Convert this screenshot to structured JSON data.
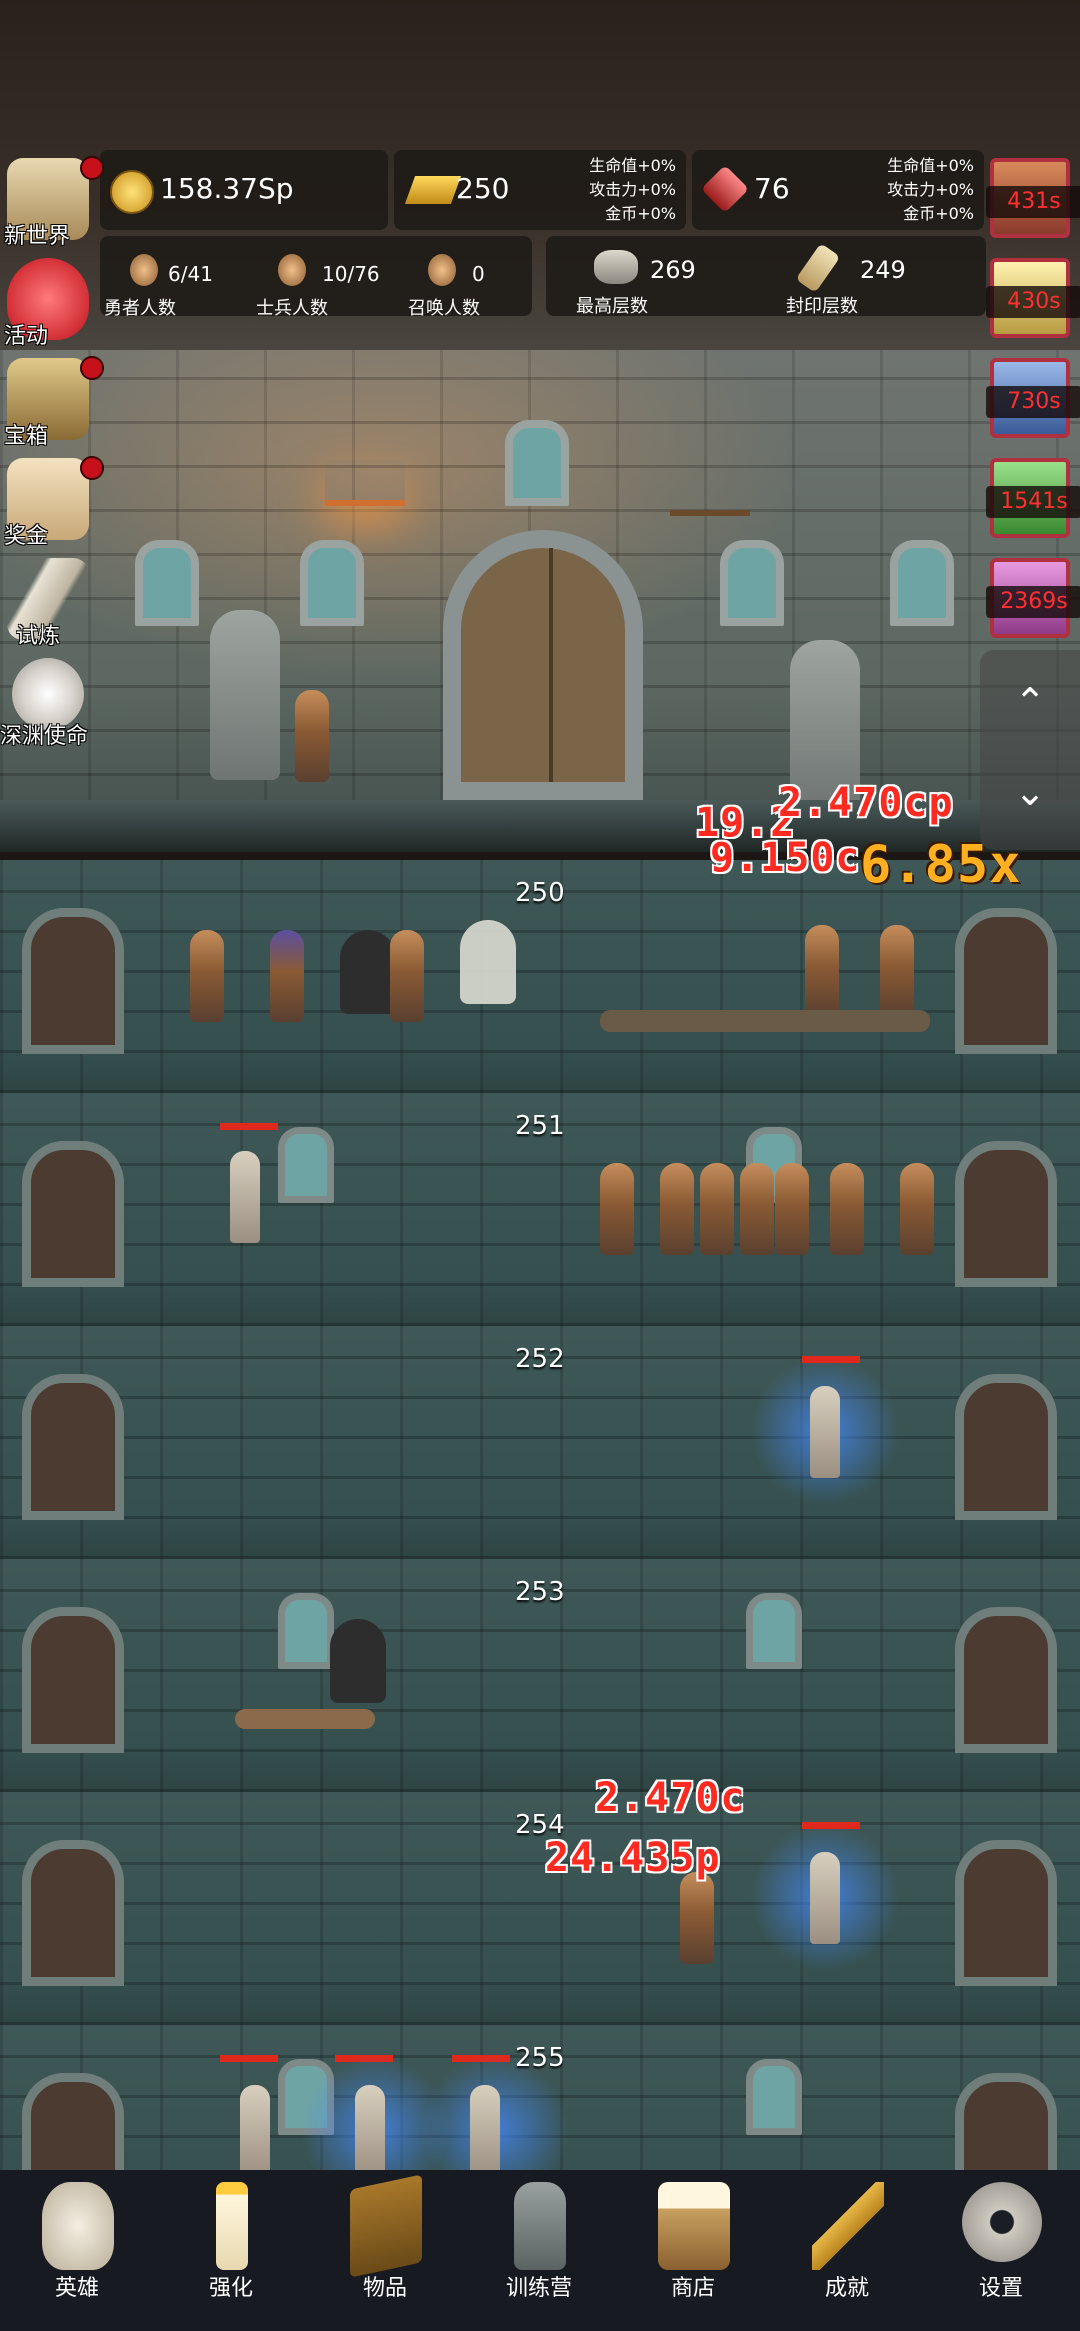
{
  "resources": {
    "coins": "158.37Sp",
    "gold_bars": "250",
    "gold_bonus": [
      "生命值+0%",
      "攻击力+0%",
      "金币+0%"
    ],
    "gems": "76",
    "gem_bonus": [
      "生命值+0%",
      "攻击力+0%",
      "金币+0%"
    ]
  },
  "stats": {
    "heroes_value": "6/41",
    "heroes_label": "勇者人数",
    "soldiers_value": "10/76",
    "soldiers_label": "士兵人数",
    "summons_value": "0",
    "summons_label": "召唤人数",
    "max_floor_value": "269",
    "max_floor_label": "最高层数",
    "sealed_floor_value": "249",
    "sealed_floor_label": "封印层数"
  },
  "left_menu": [
    {
      "label": "新世界",
      "icon": "map-icon",
      "badge": true
    },
    {
      "label": "活动",
      "icon": "heart-icon",
      "badge": false
    },
    {
      "label": "宝箱",
      "icon": "treasure-chest-icon",
      "badge": true
    },
    {
      "label": "奖金",
      "icon": "envelope-icon",
      "badge": true
    },
    {
      "label": "试炼",
      "icon": "feather-icon",
      "badge": false
    },
    {
      "label": "深渊使命",
      "icon": "pearl-icon",
      "badge": false
    }
  ],
  "buffs": [
    {
      "timer": "431s",
      "icon": "buff-chest-icon",
      "color": "#b8563a"
    },
    {
      "timer": "430s",
      "icon": "buff-candle-icon",
      "color": "#d9c66a"
    },
    {
      "timer": "730s",
      "icon": "buff-scroll-icon",
      "color": "#4f7ab8"
    },
    {
      "timer": "1541s",
      "icon": "buff-potion-icon",
      "color": "#54a050"
    },
    {
      "timer": "2369s",
      "icon": "buff-book-icon",
      "color": "#b04fa8"
    }
  ],
  "floors": [
    "250",
    "251",
    "252",
    "253",
    "254",
    "255"
  ],
  "damage_numbers": {
    "a": "2.470cp",
    "b": "19.2",
    "c": "9.150c",
    "d": "6.85x",
    "e": "2.470c",
    "f": "24.435p"
  },
  "nav": [
    {
      "label": "英雄",
      "icon": "skull-icon"
    },
    {
      "label": "强化",
      "icon": "candle-icon"
    },
    {
      "label": "物品",
      "icon": "book-icon"
    },
    {
      "label": "训练营",
      "icon": "lantern-icon"
    },
    {
      "label": "商店",
      "icon": "beer-mug-icon"
    },
    {
      "label": "成就",
      "icon": "key-icon"
    },
    {
      "label": "设置",
      "icon": "gear-icon"
    }
  ],
  "colors": {
    "accent_red": "#e0281c",
    "timer_red": "#ff3030",
    "nav_bg": "#171a21"
  }
}
